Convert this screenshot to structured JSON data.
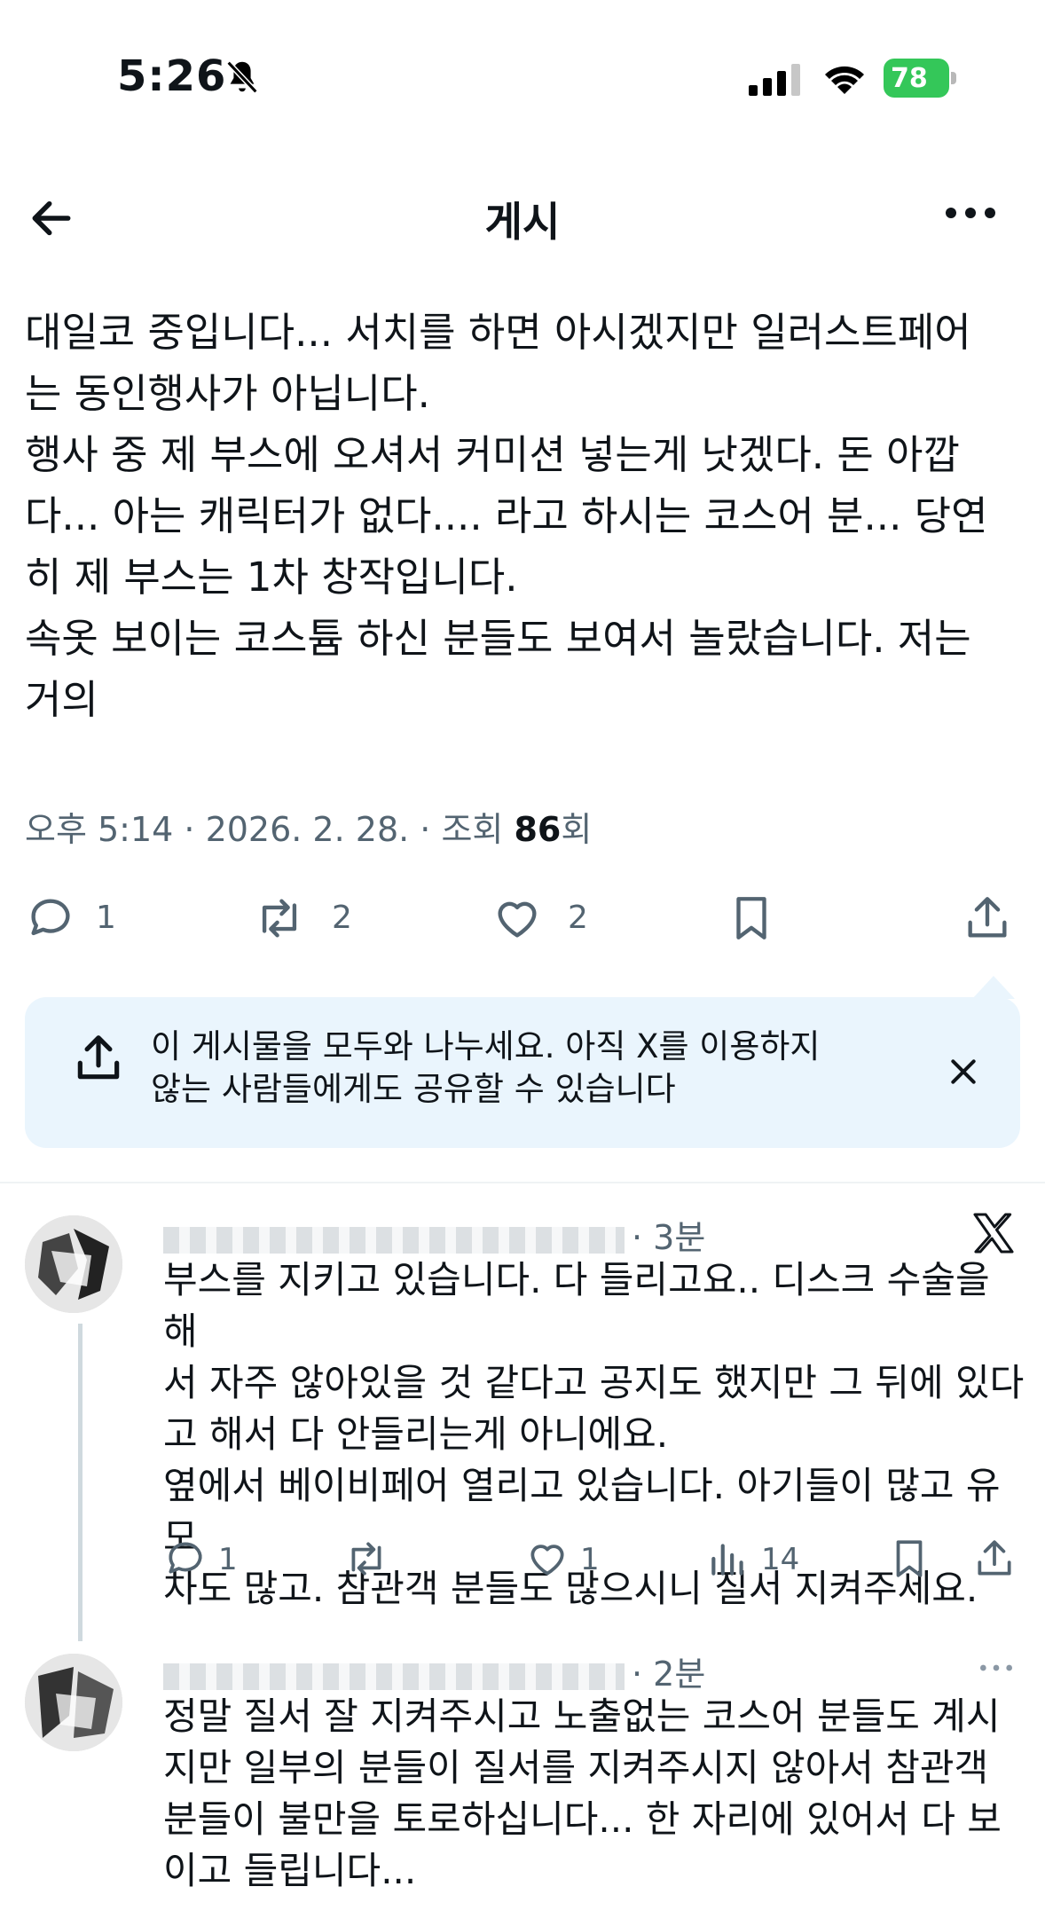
{
  "status_bar": {
    "time": "5:26",
    "battery": "78"
  },
  "nav": {
    "title": "게시"
  },
  "tweet": {
    "text": "대일코 중입니다... 서치를 하면 아시겠지만 일러스트페어\n는 동인행사가 아닙니다.\n행사 중 제 부스에 오셔서 커미션 넣는게 낫겠다. 돈 아깝\n다... 아는 캐릭터가 없다.... 라고 하시는 코스어 분... 당연\n히 제 부스는 1차 창작입니다.\n속옷 보이는 코스튬 하신 분들도 보여서 놀랐습니다. 저는\n거의",
    "meta_prefix": "오후 5:14 · 2026. 2. 28. · 조회 ",
    "views": "86",
    "meta_suffix": "회",
    "actions": {
      "replies": "1",
      "reposts": "2",
      "likes": "2"
    }
  },
  "share_banner": {
    "text": "이 게시물을 모두와 나누세요. 아직 X를 이용하지\n않는 사람들에게도 공유할 수 있습니다"
  },
  "replies": [
    {
      "time": "· 3분",
      "text": "부스를 지키고 있습니다. 다 들리고요.. 디스크 수술을 해\n서 자주 않아있을 것 같다고 공지도 했지만 그 뒤에 있다\n고 해서 다 안들리는게 아니에요.\n옆에서 베이비페어 열리고 있습니다. 아기들이 많고 유모\n차도 많고. 참관객 분들도 많으시니 질서 지켜주세요.",
      "actions": {
        "replies": "1",
        "reposts": "",
        "likes": "1",
        "views": "14"
      }
    },
    {
      "time": "· 2분",
      "text": "정말 질서 잘 지켜주시고 노출없는 코스어 분들도 계시\n지만 일부의 분들이 질서를 지켜주시지 않아서 참관객\n분들이 불만을 토로하십니다... 한 자리에 있어서 다 보\n이고 들립니다..."
    }
  ],
  "icons": {
    "status": [
      "bell-slash-icon",
      "signal-icon",
      "wifi-icon",
      "battery-icon"
    ],
    "nav": [
      "back-arrow-icon",
      "more-icon"
    ],
    "actions": [
      "reply-icon",
      "repost-icon",
      "like-icon",
      "bookmark-icon",
      "share-icon",
      "views-icon"
    ],
    "misc": [
      "x-logo-icon",
      "close-icon"
    ]
  },
  "colors": {
    "banner_bg": "#eaf5fd",
    "secondary_text": "#536471",
    "battery_green": "#34c759"
  }
}
